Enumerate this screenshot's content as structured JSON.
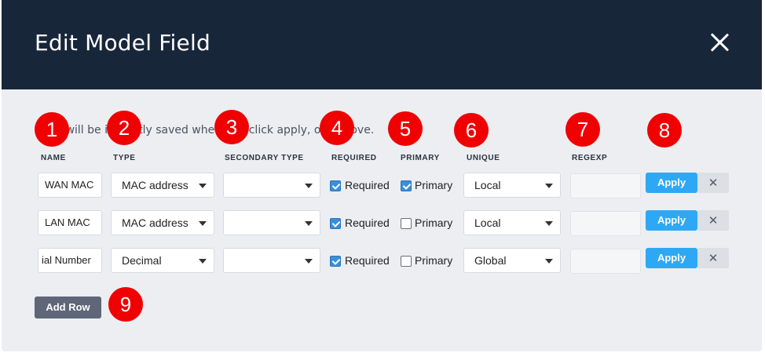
{
  "modal": {
    "title": "Edit Model Field",
    "hint": "Row will be instantly saved when you click apply, or remove."
  },
  "columns": {
    "name": "NAME",
    "type": "TYPE",
    "secondary_type": "SECONDARY TYPE",
    "required": "REQUIRED",
    "primary": "PRIMARY",
    "unique": "UNIQUE",
    "regexp": "REGEXP"
  },
  "rows": [
    {
      "name": "WAN MAC",
      "type": "MAC address",
      "secondary_type": "",
      "required": true,
      "required_label": "Required",
      "primary": true,
      "primary_label": "Primary",
      "unique": "Local",
      "regexp": "",
      "apply_label": "Apply",
      "remove_icon": "✕"
    },
    {
      "name": "LAN MAC",
      "type": "MAC address",
      "secondary_type": "",
      "required": true,
      "required_label": "Required",
      "primary": false,
      "primary_label": "Primary",
      "unique": "Local",
      "regexp": "",
      "apply_label": "Apply",
      "remove_icon": "✕"
    },
    {
      "name": "ial Number",
      "type": "Decimal",
      "secondary_type": "",
      "required": true,
      "required_label": "Required",
      "primary": false,
      "primary_label": "Primary",
      "unique": "Global",
      "regexp": "",
      "apply_label": "Apply",
      "remove_icon": "✕"
    }
  ],
  "add_row_label": "Add Row",
  "badges": [
    "1",
    "2",
    "3",
    "4",
    "5",
    "6",
    "7",
    "8",
    "9"
  ],
  "colors": {
    "header_bg": "#18263a",
    "body_bg": "#eceef2",
    "apply_blue": "#2ea8f4",
    "badge_red": "#f00000",
    "checkbox_blue": "#3a8fd8",
    "add_row_bg": "#5e6678"
  }
}
